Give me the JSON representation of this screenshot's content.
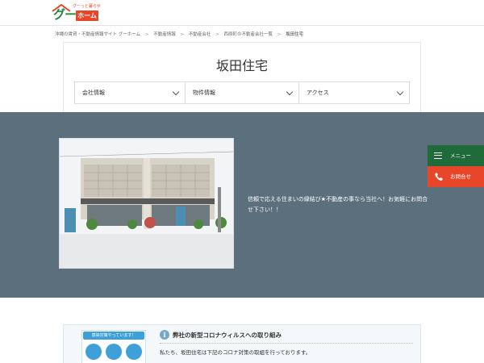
{
  "header": {
    "logo_main": "グー",
    "logo_home": "ホーム",
    "logo_tagline": "グーっと暮らせ"
  },
  "breadcrumb": {
    "items": [
      "沖縄の賃貸・不動産情報サイト グーホーム",
      "不動産情報",
      "不動産会社",
      "西原町の不動産会社一覧",
      "坂田住宅"
    ],
    "separator": ">"
  },
  "company": {
    "title": "坂田住宅",
    "description": "信頼で応える住まいの縁結び★不動産の事なら当社へ！お気軽にお問合せ下さい！！"
  },
  "nav": {
    "items": [
      {
        "label": "会社情報"
      },
      {
        "label": "物件情報"
      },
      {
        "label": "アクセス"
      }
    ]
  },
  "floating": {
    "menu_label": "メニュー",
    "contact_label": "お問合せ"
  },
  "covid": {
    "badge": "感染対策やっています！",
    "heading": "弊社の新型コロナウィルスへの取り組み",
    "body": "私たち、坂田住宅は下記のコロナ対策の取組を行っております。"
  },
  "colors": {
    "brand_green": "#1f8a3b",
    "brand_orange": "#e8462a",
    "hero_bg": "#5b6f7d",
    "menu_green": "#1f6b3a"
  },
  "icons": {
    "menu": "hamburger-icon",
    "contact": "phone-icon",
    "nav": "chevron-down-icon",
    "info": "info-icon"
  }
}
